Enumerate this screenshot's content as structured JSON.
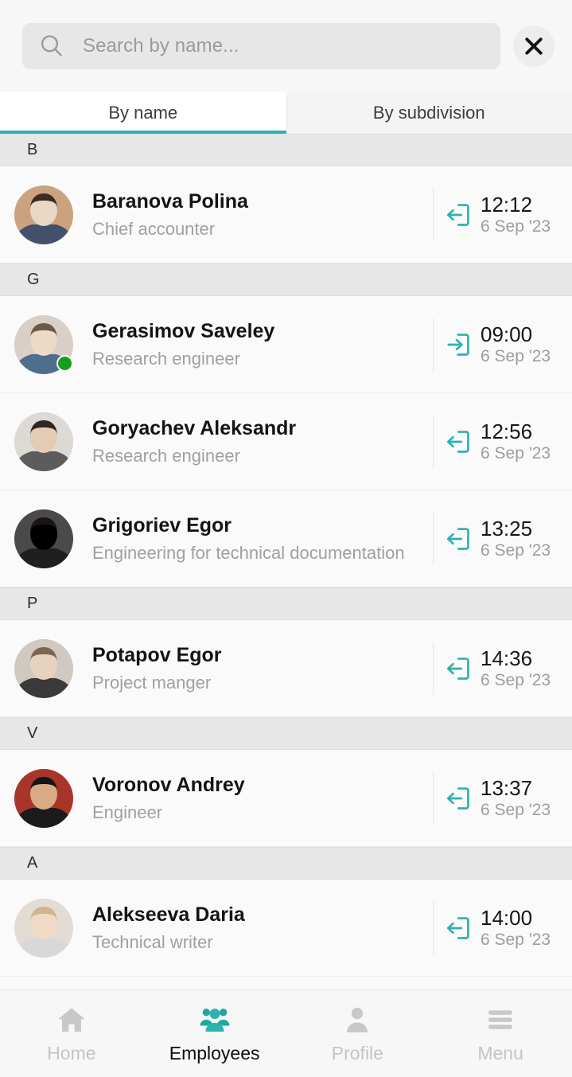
{
  "search": {
    "placeholder": "Search by name...",
    "value": "",
    "icon": "search-icon",
    "close_icon": "close-icon"
  },
  "tabs": [
    {
      "label": "By name",
      "active": true
    },
    {
      "label": "By subdivision",
      "active": false
    }
  ],
  "colors": {
    "accent": "#2bb3ad",
    "online": "#14a01a",
    "section_bg": "#e7e7e7",
    "row_bg": "#fafafa",
    "muted_text": "#a0a0a0"
  },
  "sections": [
    {
      "letter": "B",
      "employees": [
        {
          "name": "Baranova Polina",
          "position": "Chief accounter",
          "time": "12:12",
          "date": "6 Sep '23",
          "direction": "out",
          "direction_icon": "arrow-left-exit-icon",
          "online": false,
          "avatar": "woman-long-hair-striped-shirt"
        }
      ]
    },
    {
      "letter": "G",
      "employees": [
        {
          "name": "Gerasimov Saveley",
          "position": "Research engineer",
          "time": "09:00",
          "date": "6 Sep '23",
          "direction": "in",
          "direction_icon": "arrow-right-enter-icon",
          "online": true,
          "avatar": "man-short-hair-blue-shirt"
        },
        {
          "name": "Goryachev Aleksandr",
          "position": "Research engineer",
          "time": "12:56",
          "date": "6 Sep '23",
          "direction": "out",
          "direction_icon": "arrow-left-exit-icon",
          "online": false,
          "avatar": "man-curly-hair-grey-shirt"
        },
        {
          "name": "Grigoriev Egor",
          "position": "Engineering for technical documentation",
          "time": "13:25",
          "date": "6 Sep '23",
          "direction": "out",
          "direction_icon": "arrow-left-exit-icon",
          "online": false,
          "avatar": "man-beard-dark-jacket"
        }
      ]
    },
    {
      "letter": "P",
      "employees": [
        {
          "name": "Potapov Egor",
          "position": "Project manger",
          "time": "14:36",
          "date": "6 Sep '23",
          "direction": "out",
          "direction_icon": "arrow-left-exit-icon",
          "online": false,
          "avatar": "young-man-wavy-hair"
        }
      ]
    },
    {
      "letter": "V",
      "employees": [
        {
          "name": "Voronov Andrey",
          "position": "Engineer",
          "time": "13:37",
          "date": "6 Sep '23",
          "direction": "out",
          "direction_icon": "arrow-left-exit-icon",
          "online": false,
          "avatar": "man-full-beard-red-bg"
        }
      ]
    },
    {
      "letter": "A",
      "employees": [
        {
          "name": "Alekseeva Daria",
          "position": "Technical writer",
          "time": "14:00",
          "date": "6 Sep '23",
          "direction": "out",
          "direction_icon": "arrow-left-exit-icon",
          "online": false,
          "avatar": "woman-short-hair-smiling"
        }
      ]
    }
  ],
  "bottom_nav": [
    {
      "label": "Home",
      "icon": "home-icon",
      "active": false
    },
    {
      "label": "Employees",
      "icon": "people-icon",
      "active": true
    },
    {
      "label": "Profile",
      "icon": "person-icon",
      "active": false
    },
    {
      "label": "Menu",
      "icon": "hamburger-icon",
      "active": false
    }
  ]
}
